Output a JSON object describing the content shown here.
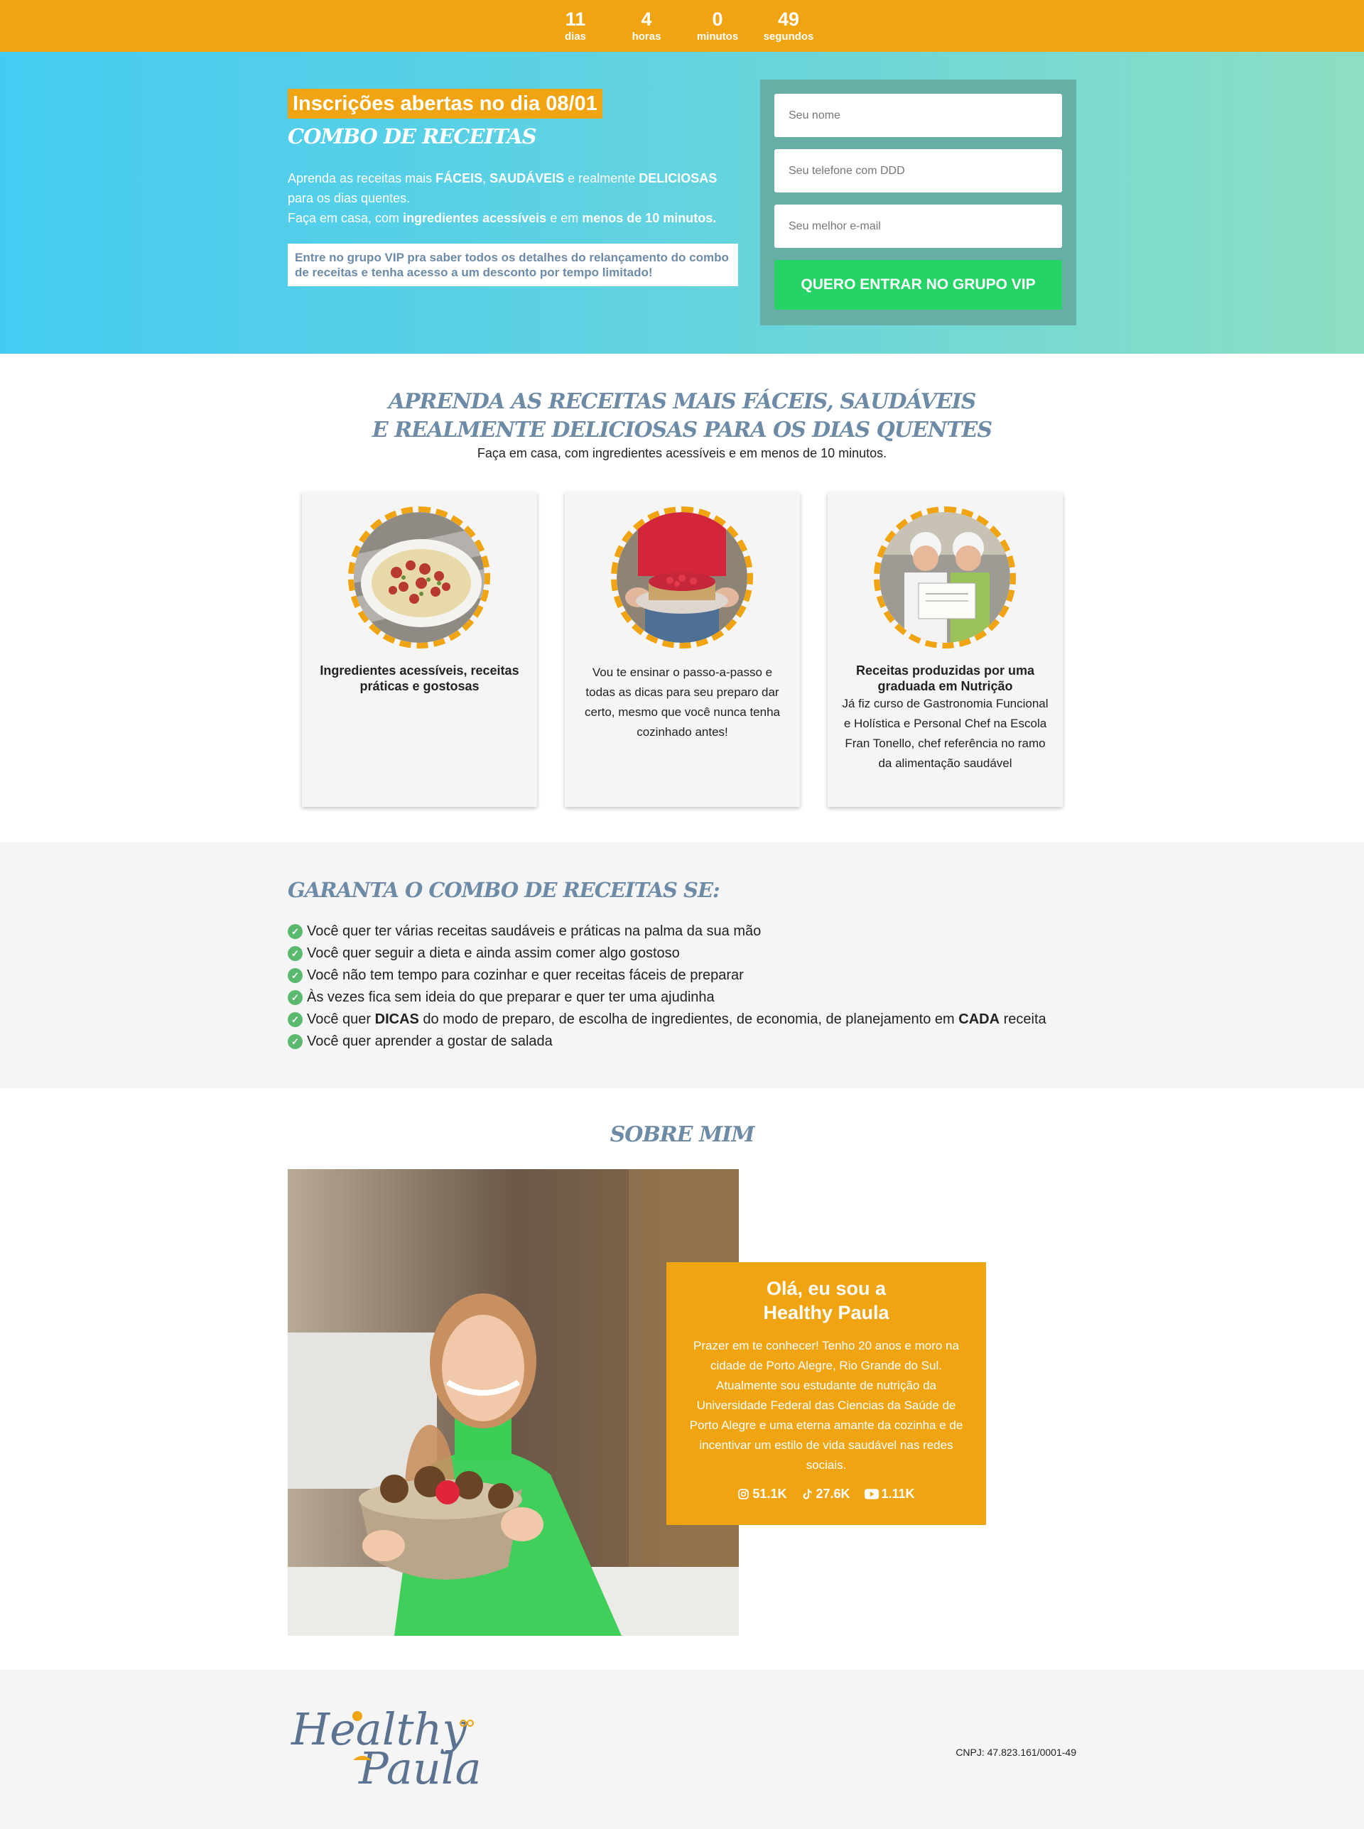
{
  "countdown": {
    "days": "11",
    "days_label": "dias",
    "hours": "4",
    "hours_label": "horas",
    "minutes": "0",
    "minutes_label": "minutos",
    "seconds": "49",
    "seconds_label": "segundos"
  },
  "hero": {
    "badge": "Inscrições abertas no dia 08/01",
    "title": "COMBO DE RECEITAS",
    "desc_1": "Aprenda as receitas mais ",
    "desc_b1": "FÁCEIS",
    "desc_2": ", ",
    "desc_b2": "SAUDÁVEIS",
    "desc_3": " e realmente ",
    "desc_b3": "DELICIOSAS",
    "desc_4": " para os dias quentes.",
    "desc_5": "Faça em casa, com ",
    "desc_b4": "ingredientes acessíveis",
    "desc_6": " e em ",
    "desc_b5": "menos de 10 minutos.",
    "note": "Entre no grupo VIP pra saber todos os detalhes do relançamento do combo de receitas e tenha acesso a um desconto por tempo limitado!",
    "form": {
      "name_placeholder": "Seu nome",
      "phone_placeholder": "Seu telefone com DDD",
      "email_placeholder": "Seu melhor e-mail",
      "submit_label": "QUERO ENTRAR NO GRUPO VIP"
    }
  },
  "learn": {
    "title_line1": "APRENDA AS RECEITAS MAIS FÁCEIS, SAUDÁVEIS",
    "title_line2": "E REALMENTE DELICIOSAS PARA OS DIAS QUENTES",
    "subtitle": "Faça em casa, com ingredientes acessíveis e em menos de 10 minutos.",
    "cards": [
      {
        "title": "Ingredientes acessíveis, receitas práticas e gostosas",
        "text": ""
      },
      {
        "title": "",
        "text": "Vou te ensinar o passo-a-passo e todas as dicas para seu preparo dar certo, mesmo que você nunca tenha cozinhado antes!"
      },
      {
        "title": "Receitas produzidas por uma graduada em Nutrição",
        "text": "Já fiz curso de Gastronomia Funcional e Holística e Personal Chef na Escola Fran Tonello, chef referência no ramo da alimentação saudável"
      }
    ]
  },
  "guarantee": {
    "title": "GARANTA O COMBO DE RECEITAS SE:",
    "items": [
      "Você quer ter várias receitas saudáveis e práticas na palma da sua mão",
      "Você quer seguir a dieta e ainda assim comer algo gostoso",
      "Você não tem tempo para cozinhar e quer receitas fáceis de preparar",
      "Às vezes fica sem ideia do que preparar e quer ter uma ajudinha"
    ],
    "item5_a": "Você quer ",
    "item5_b": "DICAS",
    "item5_c": " do modo de preparo, de escolha de ingredientes, de economia, de planejamento em ",
    "item5_d": "CADA",
    "item5_e": " receita",
    "item6": "Você quer aprender a gostar de salada"
  },
  "about": {
    "title": "SOBRE MIM",
    "greeting_line1": "Olá, eu sou a",
    "greeting_line2": "Healthy Paula",
    "bio": "Prazer em te conhecer! Tenho 20 anos e moro na cidade de Porto Alegre, Rio Grande do Sul. Atualmente sou estudante de nutrição da Universidade Federal das Ciencias da Saúde de Porto Alegre e uma eterna amante da cozinha e de incentivar um estilo de vida saudável nas redes sociais.",
    "instagram": "51.1K",
    "tiktok": "27.6K",
    "youtube": "1.11K"
  },
  "footer": {
    "logo_line1": "Healthy",
    "logo_line2": "Paula",
    "cnpj": "CNPJ: 47.823.161/0001-49"
  },
  "colors": {
    "accent": "#f0a412",
    "title_blue": "#6d8aa6",
    "cta_green": "#26d366",
    "check_green": "#5bb86f"
  }
}
